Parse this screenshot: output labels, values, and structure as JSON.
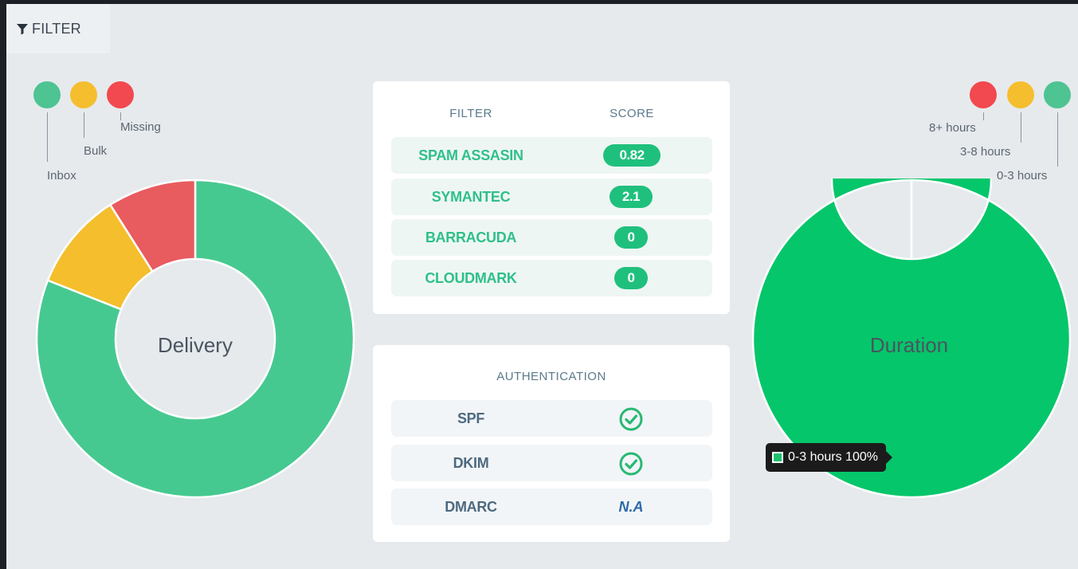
{
  "filter_button": {
    "label": "FILTER"
  },
  "delivery_legend": [
    {
      "label": "Inbox",
      "color": "#4dc492"
    },
    {
      "label": "Bulk",
      "color": "#f5be2e"
    },
    {
      "label": "Missing",
      "color": "#f2484f"
    }
  ],
  "delivery_chart": {
    "title": "Delivery",
    "chart_data": {
      "type": "pie",
      "title": "Delivery",
      "series": [
        {
          "name": "Inbox",
          "value": 81,
          "color": "#46c990"
        },
        {
          "name": "Bulk",
          "value": 10,
          "color": "#f4be2d"
        },
        {
          "name": "Missing",
          "value": 9,
          "color": "#e85b5f"
        }
      ]
    }
  },
  "filter_card": {
    "header_filter": "FILTER",
    "header_score": "SCORE",
    "rows": [
      {
        "name": "SPAM ASSASIN",
        "score": "0.82"
      },
      {
        "name": "SYMANTEC",
        "score": "2.1"
      },
      {
        "name": "BARRACUDA",
        "score": "0"
      },
      {
        "name": "CLOUDMARK",
        "score": "0"
      }
    ]
  },
  "auth_card": {
    "header": "AUTHENTICATION",
    "rows": [
      {
        "name": "SPF",
        "status": "check-icon"
      },
      {
        "name": "DKIM",
        "status": "check-icon"
      },
      {
        "name": "DMARC",
        "status": "N.A"
      }
    ]
  },
  "duration_legend": [
    {
      "label": "8+ hours",
      "color": "#f2484f"
    },
    {
      "label": "3-8 hours",
      "color": "#f5be2e"
    },
    {
      "label": "0-3 hours",
      "color": "#4dc492"
    }
  ],
  "duration_chart": {
    "title": "Duration",
    "chart_data": {
      "type": "pie",
      "title": "Duration",
      "series": [
        {
          "name": "0-3 hours",
          "value": 100,
          "color": "#05c66a"
        }
      ]
    },
    "tooltip": "0-3 hours 100%"
  }
}
